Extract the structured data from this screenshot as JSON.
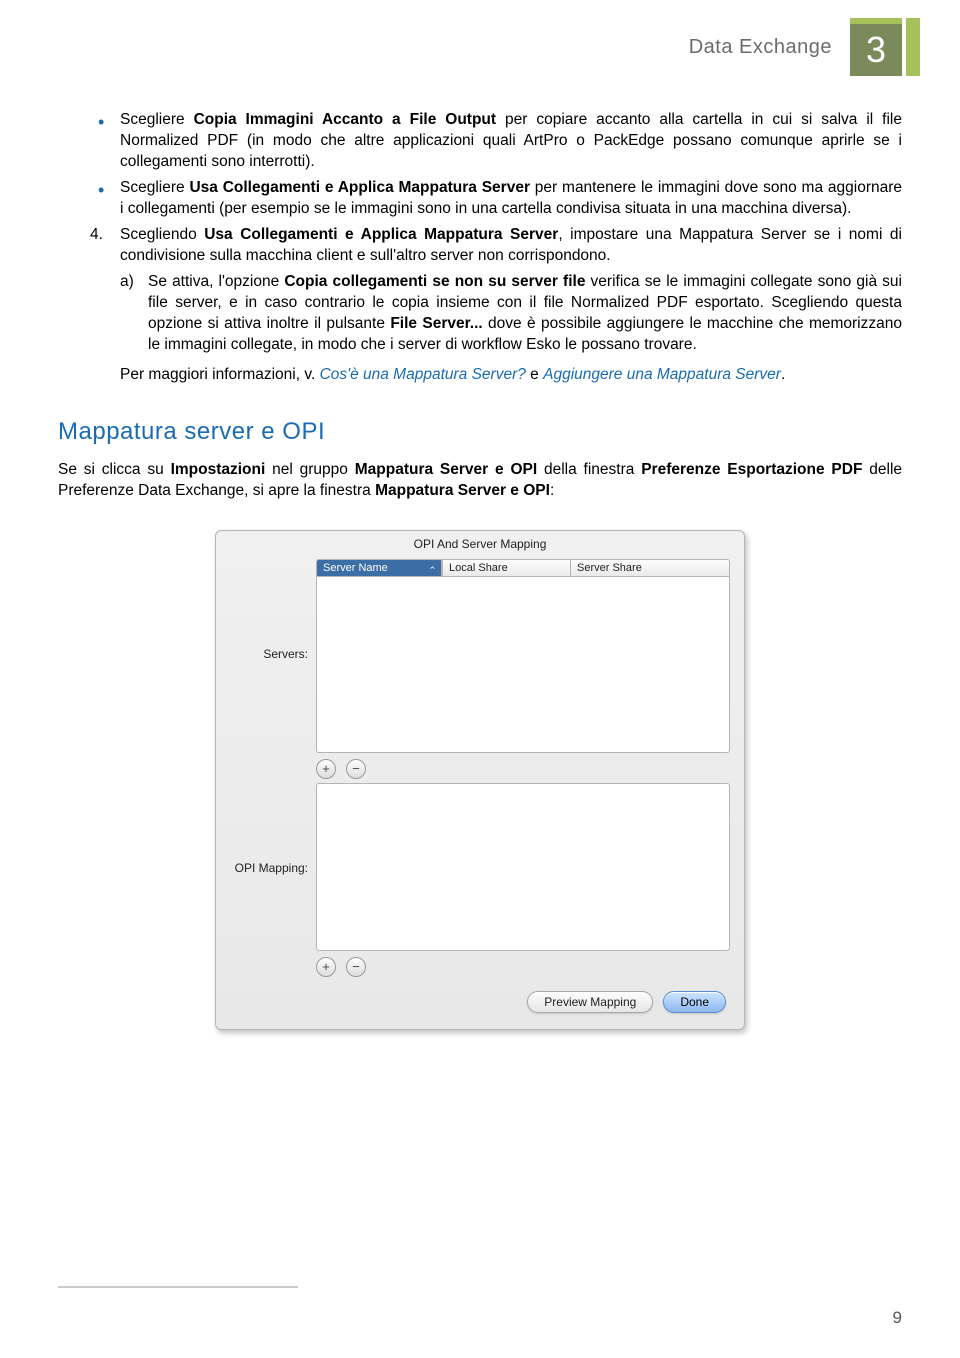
{
  "header": {
    "title": "Data Exchange",
    "chapter": "3"
  },
  "bullets": [
    {
      "pre": "Scegliere ",
      "bold": "Copia Immagini Accanto a File Output",
      "post": " per copiare accanto alla cartella in cui si salva il file Normalized PDF (in modo che altre applicazioni quali ArtPro o PackEdge possano comunque aprirle se i collegamenti sono interrotti)."
    },
    {
      "pre": "Scegliere ",
      "bold": "Usa Collegamenti e Applica Mappatura Server",
      "post": " per mantenere le immagini dove sono ma aggiornare i collegamenti (per esempio se le immagini sono in una cartella condivisa situata in una macchina diversa)."
    }
  ],
  "num_item": {
    "marker": "4.",
    "pre": "Scegliendo ",
    "bold": "Usa Collegamenti e Applica Mappatura Server",
    "post": ", impostare una Mappatura Server se i nomi di condivisione sulla macchina client e sull'altro server non corrispondono."
  },
  "sub_item": {
    "marker": "a)",
    "text_parts": [
      "Se attiva, l'opzione ",
      "Copia collegamenti se non su server file",
      " verifica se le immagini collegate sono già sui file server, e in caso contrario le copia insieme con il file Normalized PDF esportato. Scegliendo questa opzione si attiva inoltre il pulsante ",
      "File Server...",
      " dove è possibile aggiungere le macchine che memorizzano le immagini collegate, in modo che i server di workflow Esko le possano trovare."
    ]
  },
  "info": {
    "pre": "Per maggiori informazioni, v. ",
    "link1": "Cos'è una Mappatura Server?",
    "mid": " e ",
    "link2": "Aggiungere una Mappatura Server",
    "end": "."
  },
  "section": {
    "heading": "Mappatura server e OPI",
    "p_parts": [
      "Se si clicca su ",
      "Impostazioni",
      " nel gruppo ",
      "Mappatura Server e OPI",
      " della finestra ",
      "Preferenze Esportazione PDF",
      " delle Preferenze Data Exchange, si apre la finestra ",
      "Mappatura Server e OPI",
      ":"
    ]
  },
  "dialog": {
    "title": "OPI And Server Mapping",
    "servers_label": "Servers:",
    "opi_label": "OPI Mapping:",
    "cols": {
      "c1": "Server Name",
      "c2": "Local Share",
      "c3": "Server Share"
    },
    "add": "+",
    "remove": "−",
    "preview": "Preview Mapping",
    "done": "Done"
  },
  "page_number": "9"
}
